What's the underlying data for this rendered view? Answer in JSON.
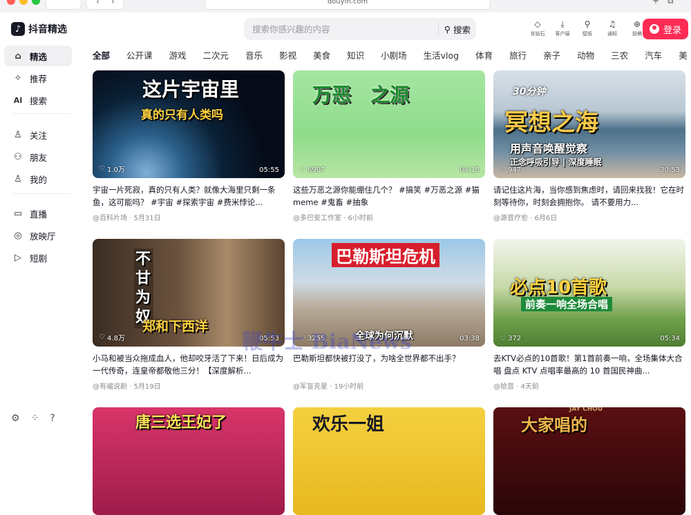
{
  "browser": {
    "url": "douyin.com",
    "back": "‹",
    "forward": "›"
  },
  "sidebar": {
    "logo_text": "抖音精选",
    "items": [
      {
        "label": "精选",
        "icon": "home-icon",
        "glyph": "⌂",
        "active": true
      },
      {
        "label": "推荐",
        "icon": "sparkle-icon",
        "glyph": "✧"
      },
      {
        "label": "搜索",
        "icon": "ai-search-icon",
        "glyph": "AI"
      },
      {
        "label": "关注",
        "icon": "follow-icon",
        "glyph": "♙"
      },
      {
        "label": "朋友",
        "icon": "friends-icon",
        "glyph": "⚇"
      },
      {
        "label": "我的",
        "icon": "profile-icon",
        "glyph": "♙"
      },
      {
        "label": "直播",
        "icon": "live-tv-icon",
        "glyph": "▭"
      },
      {
        "label": "放映厅",
        "icon": "cinema-icon",
        "glyph": "◎"
      },
      {
        "label": "短剧",
        "icon": "short-drama-icon",
        "glyph": "▷"
      }
    ],
    "bottom_icons": [
      "settings-icon",
      "apps-icon",
      "help-icon"
    ]
  },
  "header": {
    "search_placeholder": "搜索你感兴趣的内容",
    "search_button": "搜索",
    "tools": [
      {
        "label": "充钻石",
        "icon": "diamond-icon",
        "glyph": "◇"
      },
      {
        "label": "客户端",
        "icon": "download-icon",
        "glyph": "⤓"
      },
      {
        "label": "壁纸",
        "icon": "wallpaper-icon",
        "glyph": "⚲"
      },
      {
        "label": "通知",
        "icon": "bell-icon",
        "glyph": "♫"
      },
      {
        "label": "投稿",
        "icon": "upload-icon",
        "glyph": "⊕"
      }
    ],
    "login_label": "登录"
  },
  "tabs": [
    "全部",
    "公开课",
    "游戏",
    "二次元",
    "音乐",
    "影视",
    "美食",
    "知识",
    "小剧场",
    "生活vlog",
    "体育",
    "旅行",
    "亲子",
    "动物",
    "三农",
    "汽车",
    "美"
  ],
  "videos": [
    {
      "thumb_title": "这片宇宙里",
      "thumb_sub": "真的只有人类吗",
      "likes": "1.0万",
      "duration": "05:55",
      "desc": "宇宙一片死寂，真的只有人类？就像大海里只剩一条鱼，这可能吗？ #宇宙 #探索宇宙 #费米悖论...",
      "author": "@百科片场",
      "time": "5月31日"
    },
    {
      "thumb_title": "万恶　之源",
      "thumb_sub": "",
      "likes": "6907",
      "duration": "04:15",
      "desc": "这些万恶之源你能绷住几个？ #搞笑 #万恶之源 #猫meme #鬼畜 #抽象",
      "author": "@多巴安工作室",
      "time": "6小时前"
    },
    {
      "thumb_title": "冥想之海",
      "thumb_sub": "用声音唤醒觉察",
      "thumb_tag": "30分钟",
      "thumb_sub2": "正念呼吸引导 | 深度睡眠",
      "likes": "947",
      "duration": "30:53",
      "desc": "请记住这片海，当你感到焦虑时，请回来找我！它在时刻等待你，时刻会拥抱你。 请不要用力...",
      "author": "@源音疗愈",
      "time": "6月6日"
    },
    {
      "thumb_title": "不甘为奴",
      "thumb_sub": "郑和下西洋",
      "likes": "4.8万",
      "duration": "05:53",
      "desc": "小马和被当众拖成血人，他却咬牙活了下来！日后成为一代传奇，连皇帝都敬他三分！【深度解析...",
      "author": "@有福说剧",
      "time": "5月19日"
    },
    {
      "thumb_title": "巴勒斯坦危机",
      "thumb_sub": "全球为何沉默",
      "likes": "3255",
      "duration": "03:38",
      "desc": "巴勒斯坦都快被打没了，为啥全世界都不出手？",
      "author": "@军盲克星",
      "time": "19小时前"
    },
    {
      "thumb_title": "必点10首歌",
      "thumb_sub": "前奏一响全场合唱",
      "likes": "372",
      "duration": "05:34",
      "desc": "去KTV必点的10首歌！第1首前奏一响，全场集体大合唱 盘点 KTV 点唱率最高的 10 首国民神曲...",
      "author": "@拾音",
      "time": "4天前"
    },
    {
      "thumb_title": "唐三选王妃了",
      "thumb_sub": "",
      "likes": "",
      "duration": "",
      "desc": "",
      "author": "",
      "time": ""
    },
    {
      "thumb_title": "欢乐一姐",
      "thumb_sub": "",
      "likes": "",
      "duration": "",
      "desc": "",
      "author": "",
      "time": ""
    },
    {
      "thumb_title": "大家唱的",
      "thumb_sub": "JAY CHOU",
      "likes": "",
      "duration": "",
      "desc": "",
      "author": "",
      "time": ""
    }
  ],
  "watermark": "鞭牛士 BiaNews",
  "colors": {
    "accent": "#fe2c55",
    "active_bg": "#f0f0f2",
    "text": "#161823",
    "muted": "#8a8a90"
  }
}
